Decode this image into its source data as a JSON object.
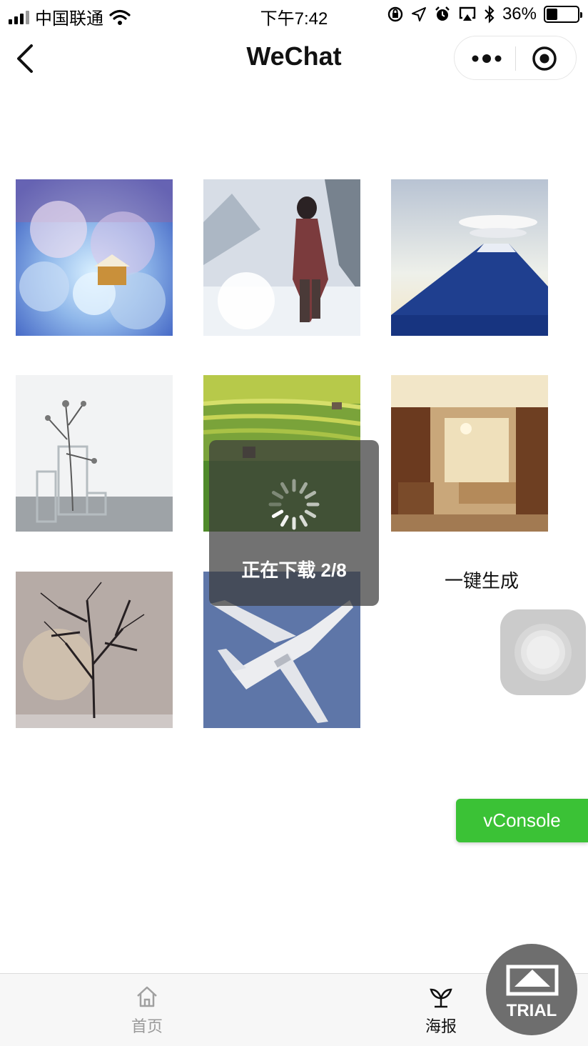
{
  "status_bar": {
    "carrier": "中国联通",
    "time": "下午7:42",
    "battery": "36%",
    "battery_level": 0.36
  },
  "nav": {
    "title": "WeChat"
  },
  "gallery": {
    "images": [
      {
        "name": "fantasy-clouds-image",
        "subject": "floating cottage in clouds"
      },
      {
        "name": "snow-warrior-image",
        "subject": "figure in snowy mountains"
      },
      {
        "name": "mount-fuji-image",
        "subject": "snow-capped mountain with lenticular cloud"
      },
      {
        "name": "vase-branch-image",
        "subject": "glass vases with dry branch"
      },
      {
        "name": "rice-terraces-image",
        "subject": "green terraced fields"
      },
      {
        "name": "living-room-image",
        "subject": "luxury living room interior"
      },
      {
        "name": "bare-tree-image",
        "subject": "leafless tree at sunset"
      },
      {
        "name": "bomber-jet-image",
        "subject": "white jet aircraft in blue sky"
      }
    ],
    "generate_label": "一键生成"
  },
  "toast": {
    "message": "正在下载 2/8",
    "progress_current": 2,
    "progress_total": 8
  },
  "vconsole_label": "vConsole",
  "tabbar": {
    "tabs": [
      {
        "label": "首页",
        "icon": "home-icon",
        "active": false
      },
      {
        "label": "海报",
        "icon": "sprout-icon",
        "active": true
      }
    ]
  },
  "trial_badge": "TRIAL",
  "colors": {
    "vconsole_green": "#3bc236",
    "toast_bg": "#3c3c3c",
    "tab_inactive": "#9a9a9a"
  }
}
